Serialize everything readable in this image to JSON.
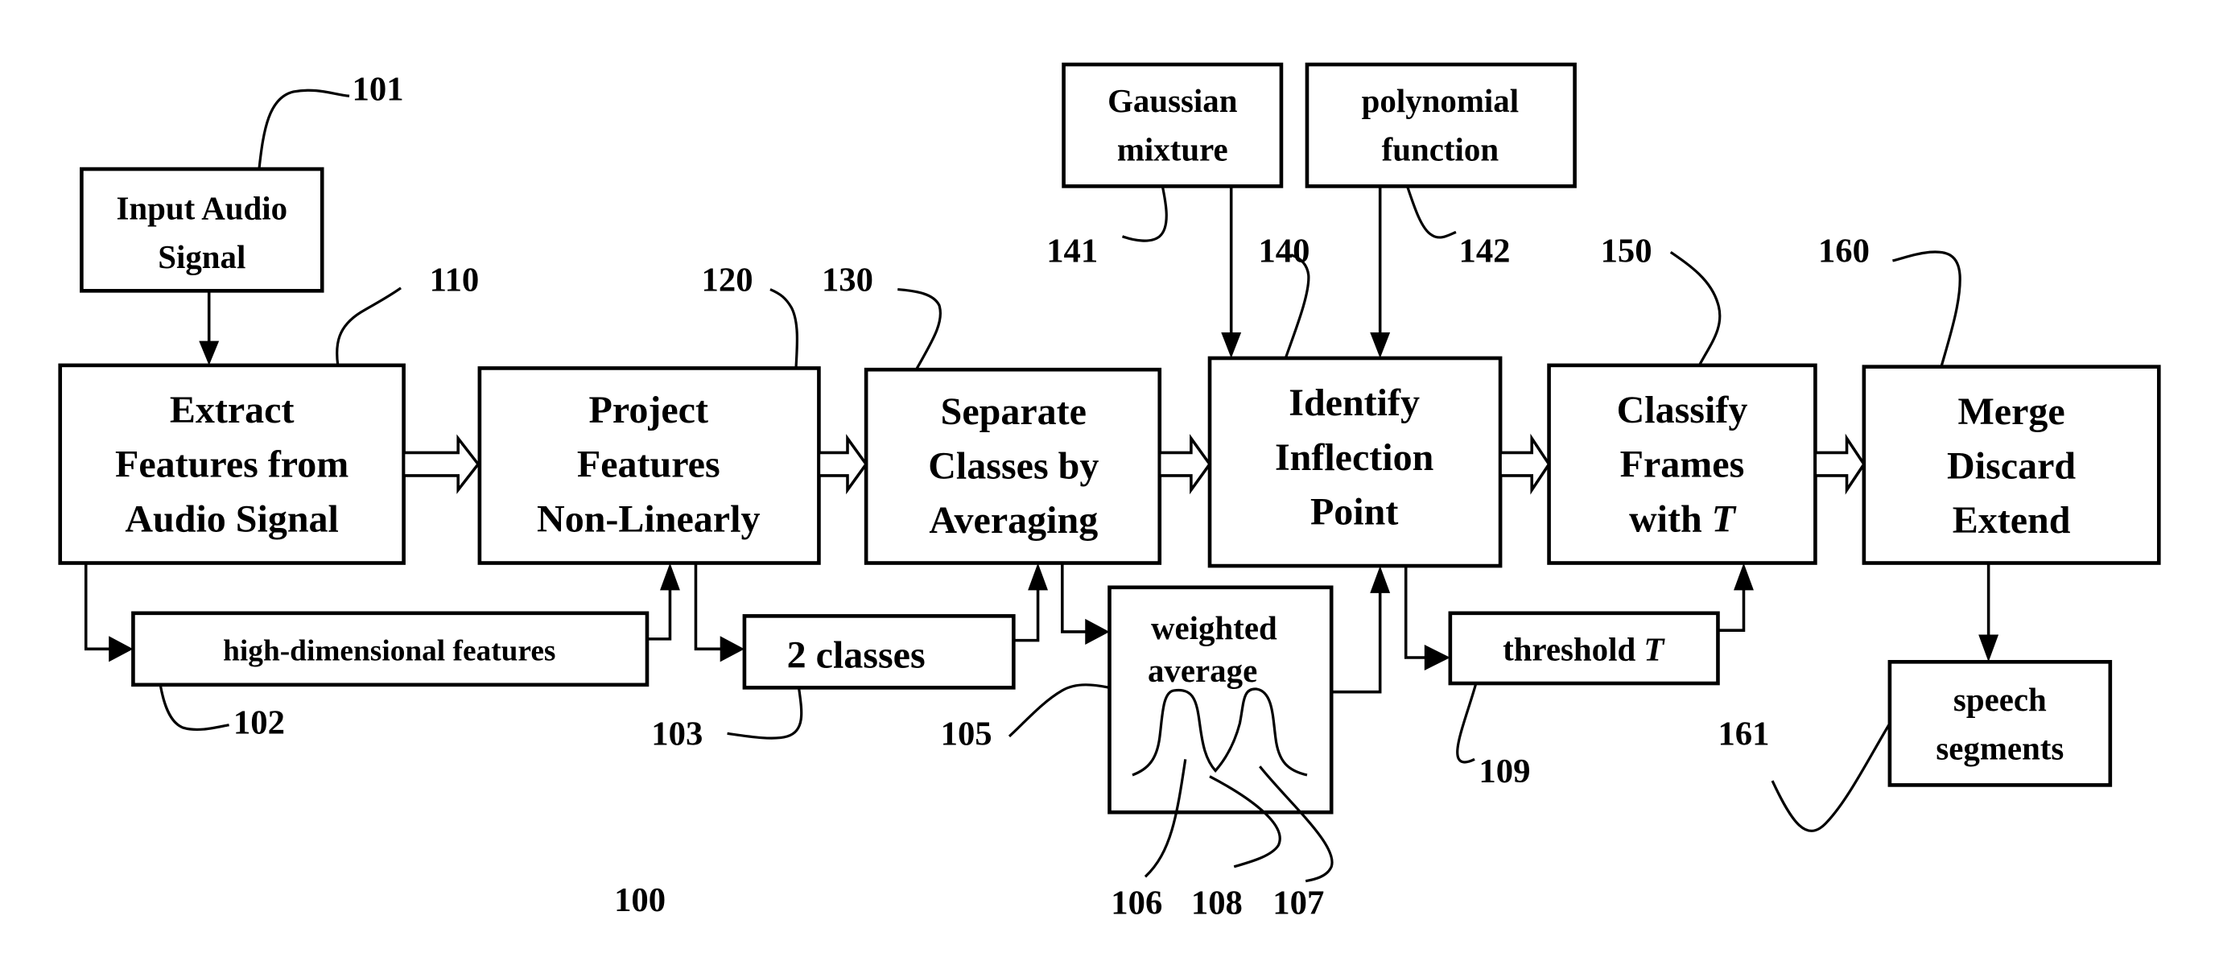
{
  "figure_number": "100",
  "colors": {
    "ink": "#000000",
    "background": "#ffffff"
  },
  "boxes": {
    "input_audio": {
      "lines": [
        "Input Audio",
        "Signal"
      ],
      "ref": "101"
    },
    "extract": {
      "lines": [
        "Extract",
        "Features from",
        "Audio Signal"
      ],
      "ref": "110"
    },
    "project": {
      "lines": [
        "Project",
        "Features",
        "Non-Linearly"
      ],
      "ref": "120"
    },
    "separate": {
      "lines": [
        "Separate",
        "Classes by",
        "Averaging"
      ],
      "ref": "130"
    },
    "identify": {
      "lines": [
        "Identify",
        "Inflection",
        "Point"
      ],
      "ref": "140"
    },
    "classify": {
      "lines": [
        "Classify",
        "Frames",
        "with "
      ],
      "italic_suffix": "T",
      "ref": "150"
    },
    "merge": {
      "lines": [
        "Merge",
        "Discard",
        "Extend"
      ],
      "ref": "160"
    },
    "gaussian": {
      "lines": [
        "Gaussian",
        "mixture"
      ],
      "ref": "141"
    },
    "polynomial": {
      "lines": [
        "polynomial",
        "function"
      ],
      "ref": "142"
    },
    "high_dim": {
      "lines": [
        "high-dimensional features"
      ],
      "ref": "102"
    },
    "two_classes": {
      "lines": [
        "2 classes"
      ],
      "ref": "103"
    },
    "weighted_average": {
      "lines": [
        "weighted",
        "average"
      ],
      "ref": "105"
    },
    "threshold": {
      "lines": [
        "threshold "
      ],
      "italic_suffix": "T",
      "ref": "109"
    },
    "speech_segments": {
      "lines": [
        "speech",
        "segments"
      ],
      "ref": "161"
    }
  },
  "curve_refs": {
    "first_class": "106",
    "second_class": "107",
    "inflection": "108"
  }
}
